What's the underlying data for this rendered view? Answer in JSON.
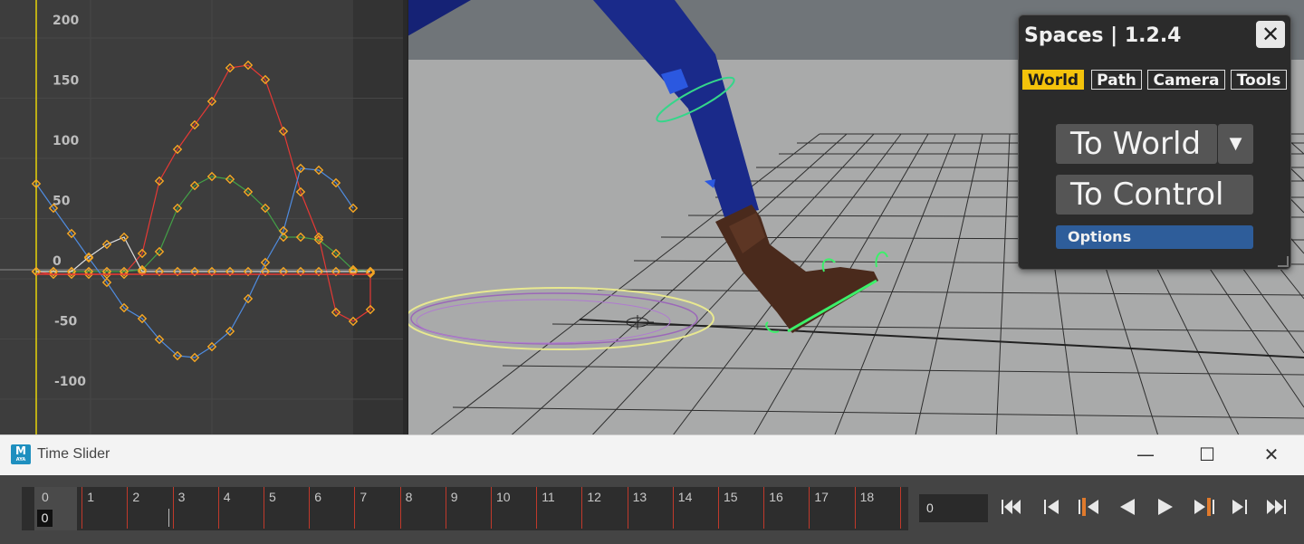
{
  "graph_editor": {
    "y_ticks": [
      "200",
      "150",
      "100",
      "50",
      "0",
      "-50",
      "-100"
    ],
    "curve_colors": {
      "red": "#e53935",
      "green": "#43a047",
      "blue": "#4f8ce0",
      "white": "#dddddd",
      "key": "#f5a623"
    }
  },
  "spaces": {
    "title": "Spaces | 1.2.4",
    "close_label": "✕",
    "tabs": [
      "World",
      "Path",
      "Camera",
      "Tools"
    ],
    "active_tab": "World",
    "to_world_label": "To World",
    "dropdown_label": "▼",
    "to_control_label": "To Control",
    "options_label": "Options"
  },
  "time_slider": {
    "window_title": "Time Slider",
    "app_icon_label": "M",
    "app_icon_sub": "AYA",
    "minimize_label": "—",
    "maximize_label": "☐",
    "close_label": "✕",
    "frames": [
      "0",
      "1",
      "2",
      "3",
      "4",
      "5",
      "6",
      "7",
      "8",
      "9",
      "10",
      "11",
      "12",
      "13",
      "14",
      "15",
      "16",
      "17",
      "18"
    ],
    "current_frame": "0",
    "frame_field_value": "0",
    "playback_buttons": [
      "go-to-start-icon",
      "step-back-frame-icon",
      "step-back-key-icon",
      "play-backwards-icon",
      "play-forwards-icon",
      "step-forward-key-icon",
      "step-forward-frame-icon",
      "go-to-end-icon"
    ]
  }
}
